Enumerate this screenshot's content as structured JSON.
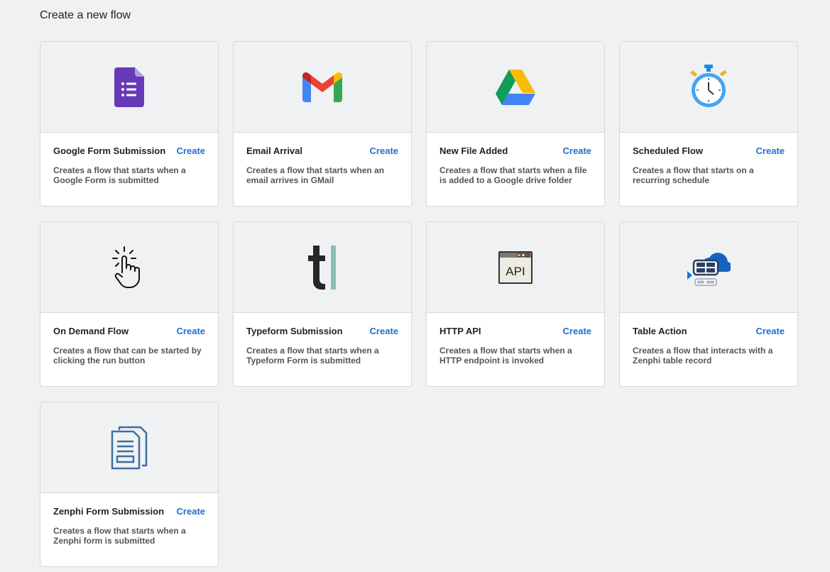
{
  "page": {
    "title": "Create a new flow"
  },
  "cards": [
    {
      "title": "Google Form Submission",
      "action": "Create",
      "description": "Creates a flow that starts when a Google Form is submitted",
      "icon": "google-forms-icon"
    },
    {
      "title": "Email Arrival",
      "action": "Create",
      "description": "Creates a flow that starts when an email arrives in GMail",
      "icon": "gmail-icon"
    },
    {
      "title": "New File Added",
      "action": "Create",
      "description": "Creates a flow that starts when a file is added to a Google drive folder",
      "icon": "google-drive-icon"
    },
    {
      "title": "Scheduled Flow",
      "action": "Create",
      "description": "Creates a flow that starts on a recurring schedule",
      "icon": "stopwatch-icon"
    },
    {
      "title": "On Demand Flow",
      "action": "Create",
      "description": "Creates a flow that can be started by clicking the run button",
      "icon": "pointer-click-icon"
    },
    {
      "title": "Typeform Submission",
      "action": "Create",
      "description": "Creates a flow that starts when a Typeform Form is submitted",
      "icon": "typeform-icon"
    },
    {
      "title": "HTTP API",
      "action": "Create",
      "description": "Creates a flow that starts when a HTTP endpoint is invoked",
      "icon": "api-window-icon",
      "icon_text": "API"
    },
    {
      "title": "Table Action",
      "action": "Create",
      "description": "Creates a flow that interacts with a Zenphi table record",
      "icon": "cloud-table-icon"
    },
    {
      "title": "Zenphi Form Submission",
      "action": "Create",
      "description": "Creates a flow that starts when a Zenphi form is submitted",
      "icon": "document-form-icon"
    }
  ],
  "colors": {
    "background": "#f0f1f3",
    "accent": "#1f6fd1",
    "card_border": "#d6d8dc"
  }
}
